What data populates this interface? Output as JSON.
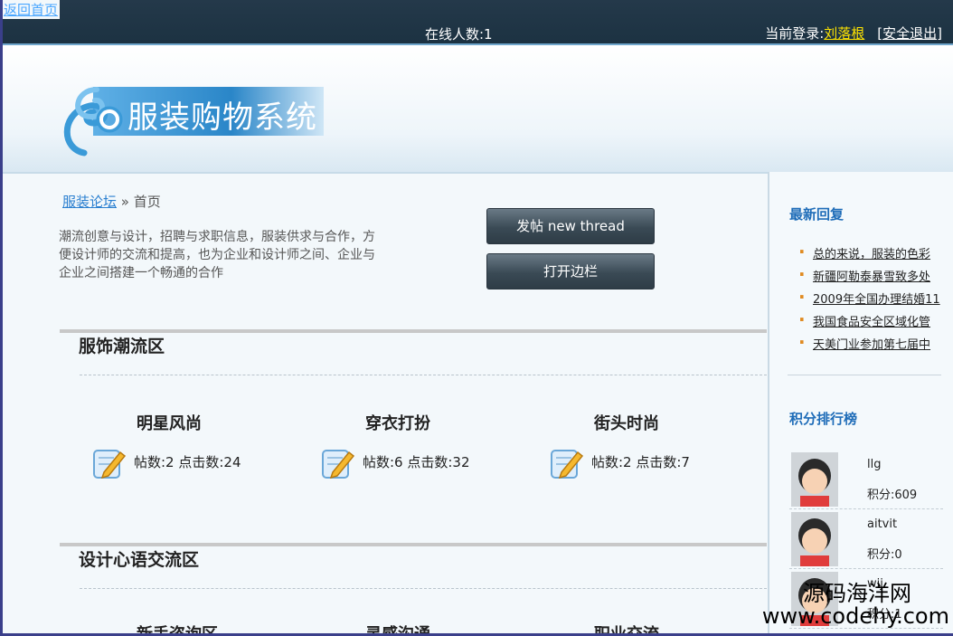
{
  "topbar": {
    "back_link": "返回首页",
    "online_label": "在线人数:1",
    "login_prefix": "当前登录:",
    "username": "刘落根",
    "logout": "[安全退出]"
  },
  "header": {
    "logo_text": "服装购物系统"
  },
  "breadcrumb": {
    "home": "服装论坛",
    "sep": "»",
    "current": "首页"
  },
  "description": "潮流创意与设计，招聘与求职信息，服装供求与合作，方便设计师的交流和提高，也为企业和设计师之间、企业与企业之间搭建一个畅通的合作",
  "buttons": {
    "new_thread": "发帖  new thread",
    "open_sidebar": "打开边栏"
  },
  "sections": [
    {
      "title": "服饰潮流区",
      "forums": [
        {
          "name": "明星风尚",
          "stats": "帖数:2 点击数:24"
        },
        {
          "name": "穿衣打扮",
          "stats": "帖数:6 点击数:32"
        },
        {
          "name": "街头时尚",
          "stats": "帖数:2 点击数:7"
        }
      ]
    },
    {
      "title": "设计心语交流区",
      "forums": [
        {
          "name": "新手咨询区",
          "stats": ""
        },
        {
          "name": "灵感沟通",
          "stats": ""
        },
        {
          "name": "职业交流",
          "stats": ""
        }
      ]
    }
  ],
  "sidebar": {
    "latest_title": "最新回复",
    "latest": [
      "总的来说，服装的色彩",
      "新疆阿勒泰暴雪致多处",
      "2009年全国办理结婚11",
      "我国食品安全区域化管",
      "天美门业参加第七届中"
    ],
    "rank_title": "积分排行榜",
    "ranks": [
      {
        "name": "llg",
        "score": "积分:609"
      },
      {
        "name": "aitvit",
        "score": "积分:0"
      },
      {
        "name": "wij",
        "score": "积分:1"
      }
    ]
  },
  "watermark": {
    "cn": "源码海洋网",
    "url": "www.codehy.com"
  },
  "icons": {
    "forum_icon": "notepad-pencil-icon",
    "logo_swirl": "swirl-logo-icon"
  }
}
